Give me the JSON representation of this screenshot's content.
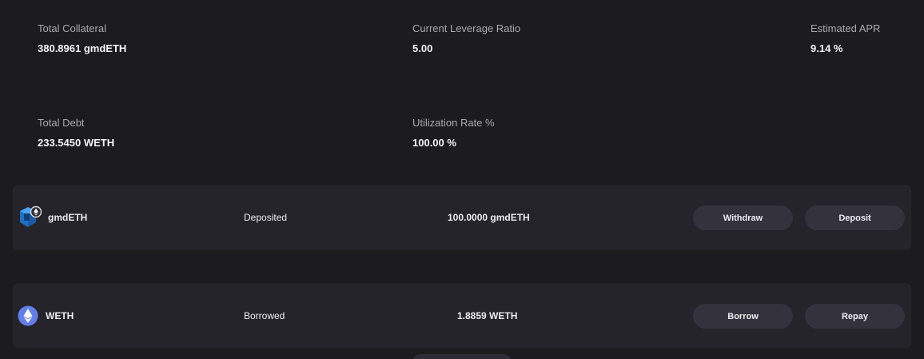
{
  "stats": {
    "total_collateral": {
      "label": "Total Collateral",
      "value": "380.8961 gmdETH"
    },
    "leverage_ratio": {
      "label": "Current Leverage Ratio",
      "value": "5.00"
    },
    "estimated_apr": {
      "label": "Estimated APR",
      "value": "9.14 %"
    },
    "total_debt": {
      "label": "Total Debt",
      "value": "233.5450 WETH"
    },
    "utilization_rate": {
      "label": "Utilization Rate %",
      "value": "100.00 %"
    }
  },
  "assets": [
    {
      "name": "gmdETH",
      "status": "Deposited",
      "amount": "100.0000 gmdETH",
      "icon": "gmdeth-token-icon",
      "action_primary": "Withdraw",
      "action_secondary": "Deposit"
    },
    {
      "name": "WETH",
      "status": "Borrowed",
      "amount": "1.8859 WETH",
      "icon": "weth-token-icon",
      "action_primary": "Borrow",
      "action_secondary": "Repay"
    }
  ],
  "colors": {
    "background": "#1c1c1e",
    "row_background": "#25242b",
    "button_background": "#34333d",
    "label_text": "#a9a9b0",
    "value_text": "#f4f4f6",
    "gmd_blue": "#2a8be0",
    "eth_blue": "#627eea"
  }
}
